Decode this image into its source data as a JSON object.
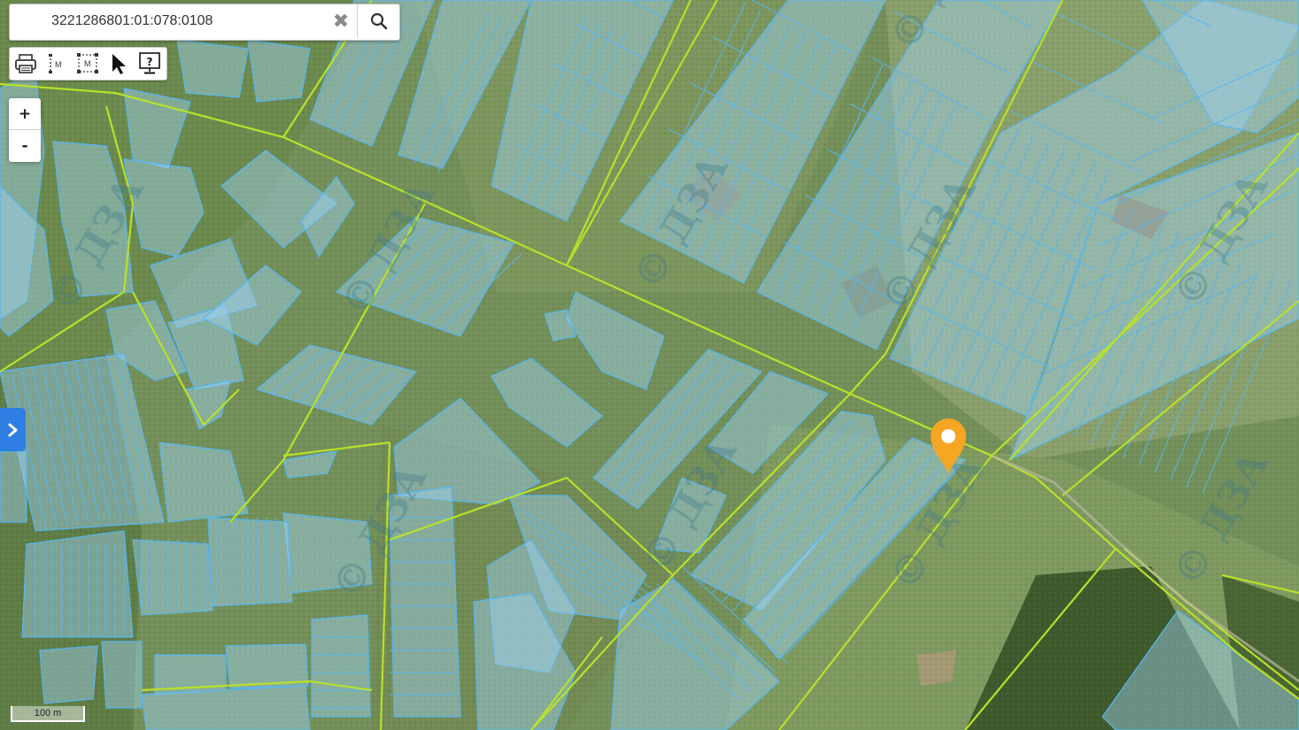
{
  "search": {
    "value": "3221286801:01:078:0108",
    "clear_icon": "close-icon",
    "search_icon": "search-icon"
  },
  "toolbar": {
    "tools": [
      "print-icon",
      "measure-distance-icon",
      "measure-area-icon",
      "select-cursor-icon",
      "help-icon"
    ],
    "measure_label": "M"
  },
  "zoom": {
    "in_label": "+",
    "out_label": "-"
  },
  "side_panel": {
    "icon": "chevron-right-icon"
  },
  "scale": {
    "label": "100 m"
  },
  "map": {
    "watermark": "© ДЗА",
    "colors": {
      "parcel_fill": "#9fd3f5",
      "parcel_stroke": "#58b6f0",
      "boundary": "#b7e12a",
      "marker": "#f5a623"
    }
  }
}
